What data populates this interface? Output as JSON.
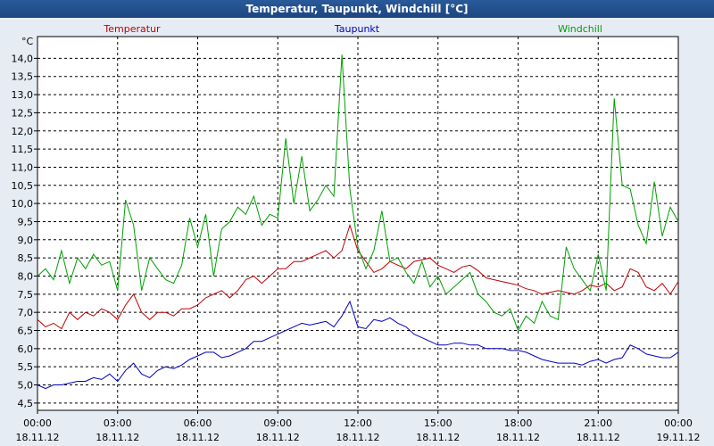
{
  "window": {
    "title": "Temperatur, Taupunkt, Windchill [°C]"
  },
  "chart_data": {
    "type": "line",
    "title": "Temperatur, Taupunkt, Windchill [°C]",
    "ylabel": "°C",
    "ylim": [
      4.3,
      14.6
    ],
    "xlim": [
      0,
      24
    ],
    "grid": true,
    "y_ticks": [
      "4,5",
      "5,0",
      "5,5",
      "6,0",
      "6,5",
      "7,0",
      "7,5",
      "8,0",
      "8,5",
      "9,0",
      "9,5",
      "10,0",
      "10,5",
      "11,0",
      "11,5",
      "12,0",
      "12,5",
      "13,0",
      "13,5",
      "14,0"
    ],
    "x_ticks": [
      {
        "time": "00:00",
        "date": "18.11.12"
      },
      {
        "time": "03:00",
        "date": "18.11.12"
      },
      {
        "time": "06:00",
        "date": "18.11.12"
      },
      {
        "time": "09:00",
        "date": "18.11.12"
      },
      {
        "time": "12:00",
        "date": "18.11.12"
      },
      {
        "time": "15:00",
        "date": "18.11.12"
      },
      {
        "time": "18:00",
        "date": "18.11.12"
      },
      {
        "time": "21:00",
        "date": "18.11.12"
      },
      {
        "time": "00:00",
        "date": "19.11.12"
      }
    ],
    "series": [
      {
        "name": "Temperatur",
        "color": "#c00000",
        "x": [
          0,
          0.3,
          0.6,
          0.9,
          1.2,
          1.5,
          1.8,
          2.1,
          2.4,
          2.7,
          3.0,
          3.3,
          3.6,
          3.9,
          4.2,
          4.5,
          4.8,
          5.1,
          5.4,
          5.7,
          6.0,
          6.3,
          6.6,
          6.9,
          7.2,
          7.5,
          7.8,
          8.1,
          8.4,
          8.7,
          9.0,
          9.3,
          9.6,
          9.9,
          10.2,
          10.5,
          10.8,
          11.1,
          11.4,
          11.7,
          12.0,
          12.3,
          12.6,
          12.9,
          13.2,
          13.5,
          13.8,
          14.1,
          14.4,
          14.7,
          15.0,
          15.3,
          15.6,
          15.9,
          16.2,
          16.5,
          16.8,
          17.1,
          17.4,
          17.7,
          18.0,
          18.3,
          18.6,
          18.9,
          19.2,
          19.5,
          19.8,
          20.1,
          20.4,
          20.7,
          21.0,
          21.3,
          21.6,
          21.9,
          22.2,
          22.5,
          22.8,
          23.1,
          23.4,
          23.7,
          24.0
        ],
        "values": [
          6.8,
          6.6,
          6.7,
          6.55,
          7.0,
          6.8,
          7.0,
          6.9,
          7.1,
          7.0,
          6.8,
          7.2,
          7.5,
          7.0,
          6.8,
          7.0,
          7.0,
          6.9,
          7.1,
          7.1,
          7.2,
          7.4,
          7.5,
          7.6,
          7.4,
          7.6,
          7.9,
          8.0,
          7.8,
          8.0,
          8.2,
          8.2,
          8.4,
          8.4,
          8.5,
          8.6,
          8.7,
          8.5,
          8.7,
          9.4,
          8.7,
          8.4,
          8.1,
          8.2,
          8.4,
          8.3,
          8.2,
          8.4,
          8.45,
          8.5,
          8.3,
          8.2,
          8.1,
          8.25,
          8.3,
          8.15,
          7.95,
          7.9,
          7.85,
          7.8,
          7.75,
          7.65,
          7.6,
          7.5,
          7.55,
          7.6,
          7.55,
          7.5,
          7.6,
          7.75,
          7.7,
          7.8,
          7.6,
          7.7,
          8.2,
          8.1,
          7.7,
          7.6,
          7.8,
          7.5,
          7.85
        ]
      },
      {
        "name": "Taupunkt",
        "color": "#0000c0",
        "x": [
          0,
          0.3,
          0.6,
          0.9,
          1.2,
          1.5,
          1.8,
          2.1,
          2.4,
          2.7,
          3.0,
          3.3,
          3.6,
          3.9,
          4.2,
          4.5,
          4.8,
          5.1,
          5.4,
          5.7,
          6.0,
          6.3,
          6.6,
          6.9,
          7.2,
          7.5,
          7.8,
          8.1,
          8.4,
          8.7,
          9.0,
          9.3,
          9.6,
          9.9,
          10.2,
          10.5,
          10.8,
          11.1,
          11.4,
          11.7,
          12.0,
          12.3,
          12.6,
          12.9,
          13.2,
          13.5,
          13.8,
          14.1,
          14.4,
          14.7,
          15.0,
          15.3,
          15.6,
          15.9,
          16.2,
          16.5,
          16.8,
          17.1,
          17.4,
          17.7,
          18.0,
          18.3,
          18.6,
          18.9,
          19.2,
          19.5,
          19.8,
          20.1,
          20.4,
          20.7,
          21.0,
          21.3,
          21.6,
          21.9,
          22.2,
          22.5,
          22.8,
          23.1,
          23.4,
          23.7,
          24.0
        ],
        "values": [
          5.0,
          4.9,
          5.0,
          5.0,
          5.05,
          5.1,
          5.1,
          5.2,
          5.15,
          5.3,
          5.1,
          5.4,
          5.6,
          5.3,
          5.2,
          5.4,
          5.5,
          5.45,
          5.55,
          5.7,
          5.8,
          5.9,
          5.9,
          5.75,
          5.8,
          5.9,
          6.0,
          6.2,
          6.2,
          6.3,
          6.4,
          6.5,
          6.6,
          6.7,
          6.65,
          6.7,
          6.75,
          6.6,
          6.9,
          7.3,
          6.6,
          6.55,
          6.8,
          6.75,
          6.85,
          6.7,
          6.6,
          6.4,
          6.3,
          6.2,
          6.1,
          6.1,
          6.15,
          6.15,
          6.1,
          6.1,
          6.0,
          6.0,
          6.0,
          5.95,
          5.95,
          5.9,
          5.8,
          5.7,
          5.65,
          5.6,
          5.6,
          5.6,
          5.55,
          5.65,
          5.7,
          5.6,
          5.7,
          5.75,
          6.1,
          6.0,
          5.85,
          5.8,
          5.75,
          5.75,
          5.9
        ]
      },
      {
        "name": "Windchill",
        "color": "#00a000",
        "x": [
          0,
          0.3,
          0.6,
          0.9,
          1.2,
          1.5,
          1.8,
          2.1,
          2.4,
          2.7,
          3.0,
          3.3,
          3.6,
          3.9,
          4.2,
          4.5,
          4.8,
          5.1,
          5.4,
          5.7,
          6.0,
          6.3,
          6.6,
          6.9,
          7.2,
          7.5,
          7.8,
          8.1,
          8.4,
          8.7,
          9.0,
          9.3,
          9.6,
          9.9,
          10.2,
          10.5,
          10.8,
          11.1,
          11.4,
          11.7,
          12.0,
          12.3,
          12.6,
          12.9,
          13.2,
          13.5,
          13.8,
          14.1,
          14.4,
          14.7,
          15.0,
          15.3,
          15.6,
          15.9,
          16.2,
          16.5,
          16.8,
          17.1,
          17.4,
          17.7,
          18.0,
          18.3,
          18.6,
          18.9,
          19.2,
          19.5,
          19.8,
          20.1,
          20.4,
          20.7,
          21.0,
          21.3,
          21.6,
          21.9,
          22.2,
          22.5,
          22.8,
          23.1,
          23.4,
          23.7,
          24.0
        ],
        "values": [
          8.0,
          8.2,
          7.9,
          8.7,
          7.8,
          8.5,
          8.2,
          8.6,
          8.3,
          8.4,
          7.6,
          10.1,
          9.4,
          7.6,
          8.5,
          8.2,
          7.9,
          7.8,
          8.3,
          9.6,
          8.8,
          9.7,
          8.0,
          9.3,
          9.5,
          9.9,
          9.7,
          10.2,
          9.4,
          9.7,
          9.6,
          11.8,
          10.0,
          11.3,
          9.8,
          10.1,
          10.5,
          10.2,
          14.1,
          10.4,
          8.8,
          8.2,
          8.7,
          9.8,
          8.4,
          8.5,
          8.1,
          7.8,
          8.4,
          7.7,
          8.0,
          7.5,
          7.7,
          7.9,
          8.1,
          7.5,
          7.3,
          7.0,
          6.9,
          7.1,
          6.5,
          6.9,
          6.7,
          7.3,
          6.9,
          6.8,
          8.8,
          8.2,
          7.9,
          7.6,
          8.6,
          7.6,
          12.9,
          10.5,
          10.4,
          9.4,
          8.9,
          10.6,
          9.1,
          9.9,
          9.5
        ]
      }
    ]
  }
}
